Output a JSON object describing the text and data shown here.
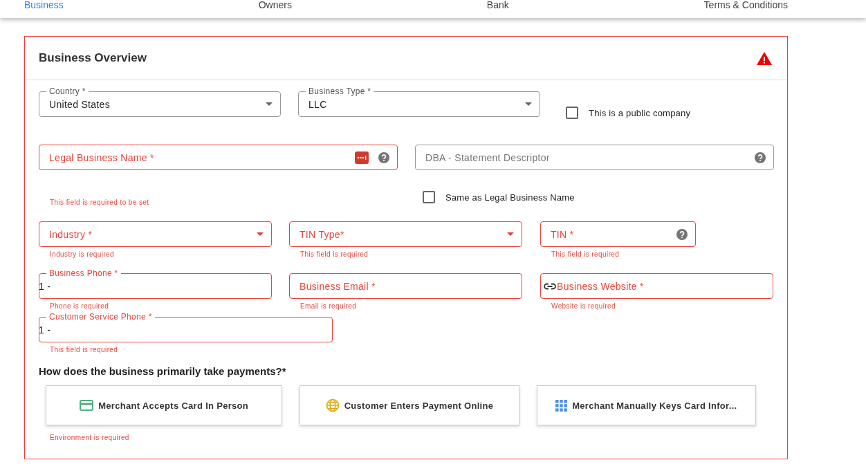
{
  "tabs": [
    {
      "label": "Business",
      "selected": true
    },
    {
      "label": "Owners",
      "selected": false
    },
    {
      "label": "Bank",
      "selected": false
    },
    {
      "label": "Terms & Conditions",
      "selected": false
    }
  ],
  "card": {
    "title": "Business Overview",
    "warning": true,
    "invalid": true
  },
  "rows": [
    [
      {
        "kind": "select",
        "label": "Country *",
        "value": "United States",
        "invalid": false
      },
      {
        "kind": "select",
        "label": "Business Type *",
        "value": "LLC",
        "invalid": false
      },
      {
        "kind": "checkbox",
        "label": "This is a public company",
        "checked": false
      }
    ],
    [
      {
        "kind": "text",
        "label": "Legal Business Name *",
        "invalid": true,
        "autofill": true,
        "help": true
      },
      {
        "kind": "text",
        "label": "DBA - Statement Descriptor",
        "invalid": false,
        "help": true
      }
    ],
    [
      {
        "kind": "note",
        "text": "This field is required to be set"
      },
      {
        "kind": "checkbox",
        "label": "Same as Legal Business Name",
        "checked": false
      }
    ],
    [
      {
        "kind": "select",
        "label": "Industry *",
        "invalid": true,
        "error": "Industry is required"
      },
      {
        "kind": "select",
        "label": "TIN Type*",
        "invalid": true,
        "error": "This field is required"
      },
      {
        "kind": "text",
        "label": "TIN *",
        "invalid": true,
        "help": true,
        "error": "This field is required"
      }
    ],
    [
      {
        "kind": "phone",
        "label": "Business Phone *",
        "value": "1 -",
        "invalid": true,
        "error": "Phone is required"
      },
      {
        "kind": "text",
        "label": "Business Email *",
        "invalid": true,
        "error": "Email is required"
      },
      {
        "kind": "url",
        "label": "Business Website *",
        "invalid": true,
        "error": "Website is required"
      }
    ],
    [
      {
        "kind": "phone",
        "label": "Customer Service Phone *",
        "value": "1 -",
        "invalid": true,
        "error": "This field is required"
      }
    ]
  ],
  "payments": {
    "question": "How does the business primarily take payments?*",
    "options": [
      {
        "label": "Merchant Accepts Card In Person",
        "kind": "card",
        "selected": false
      },
      {
        "label": "Customer Enters Payment Online",
        "kind": "online",
        "selected": false
      },
      {
        "label": "Merchant Manually Keys Card Infor...",
        "kind": "keyed",
        "selected": false
      }
    ],
    "error": "Environment is required"
  }
}
